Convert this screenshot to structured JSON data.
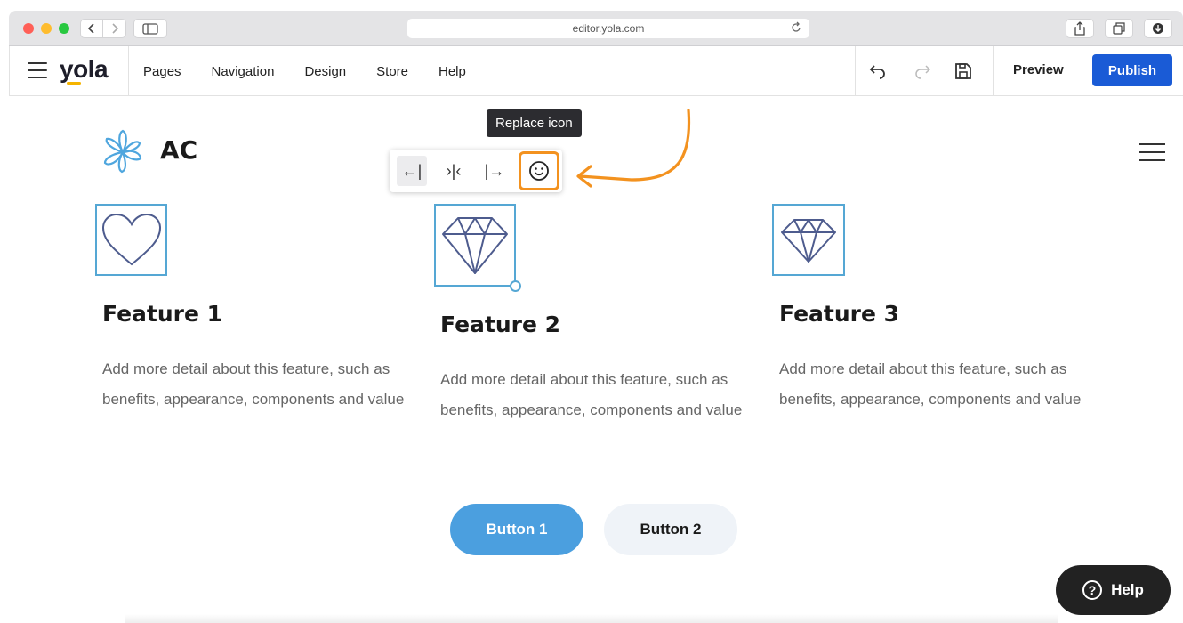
{
  "browser": {
    "url": "editor.yola.com"
  },
  "editor": {
    "logo": "yola",
    "menu": [
      "Pages",
      "Navigation",
      "Design",
      "Store",
      "Help"
    ],
    "preview_label": "Preview",
    "publish_label": "Publish",
    "publish_color": "#1a5bd6"
  },
  "site": {
    "name": "AC"
  },
  "icon_toolbar": {
    "tooltip": "Replace icon",
    "align_left_icon": "←|",
    "align_center_icon": "›|‹",
    "align_right_icon": "|→",
    "replace_icon": "☺",
    "highlight_color": "#f3921f"
  },
  "features": [
    {
      "title": "Feature 1",
      "icon": "heart-icon",
      "description": "Add more detail about this feature, such as benefits, appearance, components and value"
    },
    {
      "title": "Feature 2",
      "icon": "diamond-icon",
      "description": "Add more detail about this feature, such as benefits, appearance, components and value"
    },
    {
      "title": "Feature 3",
      "icon": "diamond-icon",
      "description": "Add more detail about this feature, such as benefits, appearance, components and value"
    }
  ],
  "buttons": {
    "button1": "Button 1",
    "button2": "Button 2"
  },
  "help": {
    "label": "Help",
    "icon": "?"
  }
}
